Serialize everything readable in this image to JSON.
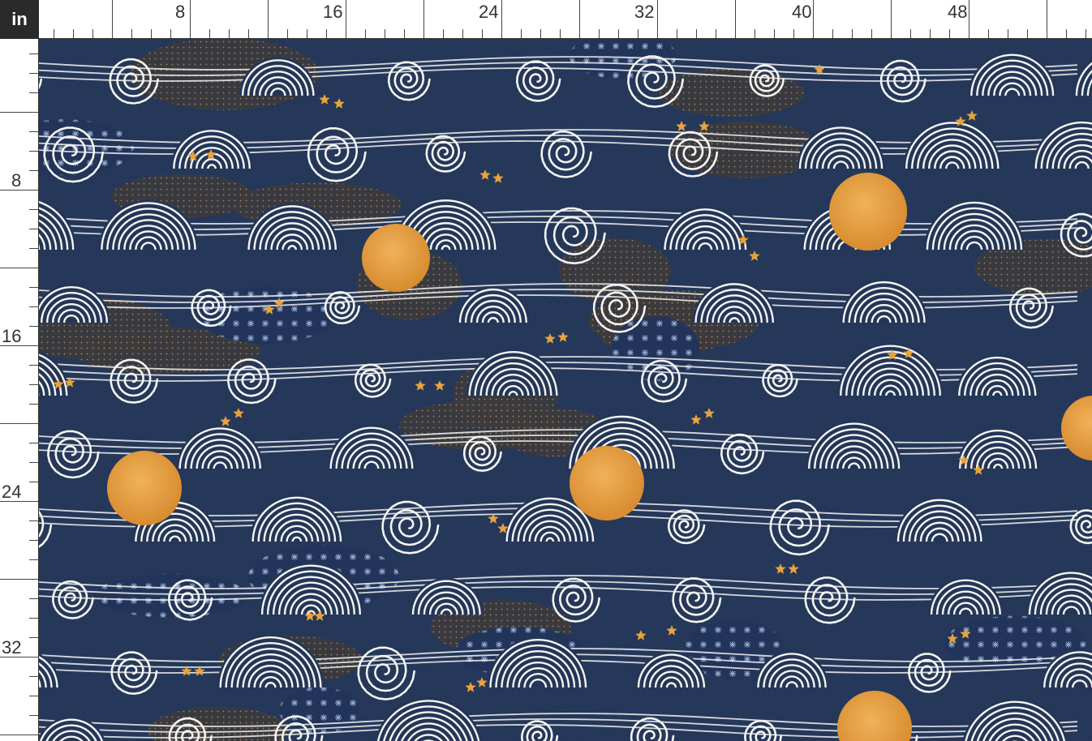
{
  "ruler": {
    "unit_label": "in",
    "top_labels": [
      "8",
      "16",
      "24",
      "32",
      "40",
      "48"
    ],
    "left_labels": [
      "8",
      "16",
      "24",
      "32"
    ]
  },
  "fabric": {
    "colors": {
      "navy": "#243657",
      "navy_dark": "#1b2a47",
      "cloud_line": "#f4f4f2",
      "charcoal": "#3b3a3d",
      "moon": "#e09a3b",
      "star": "#e7a33d",
      "accent_blue": "#3f5f8f"
    }
  }
}
